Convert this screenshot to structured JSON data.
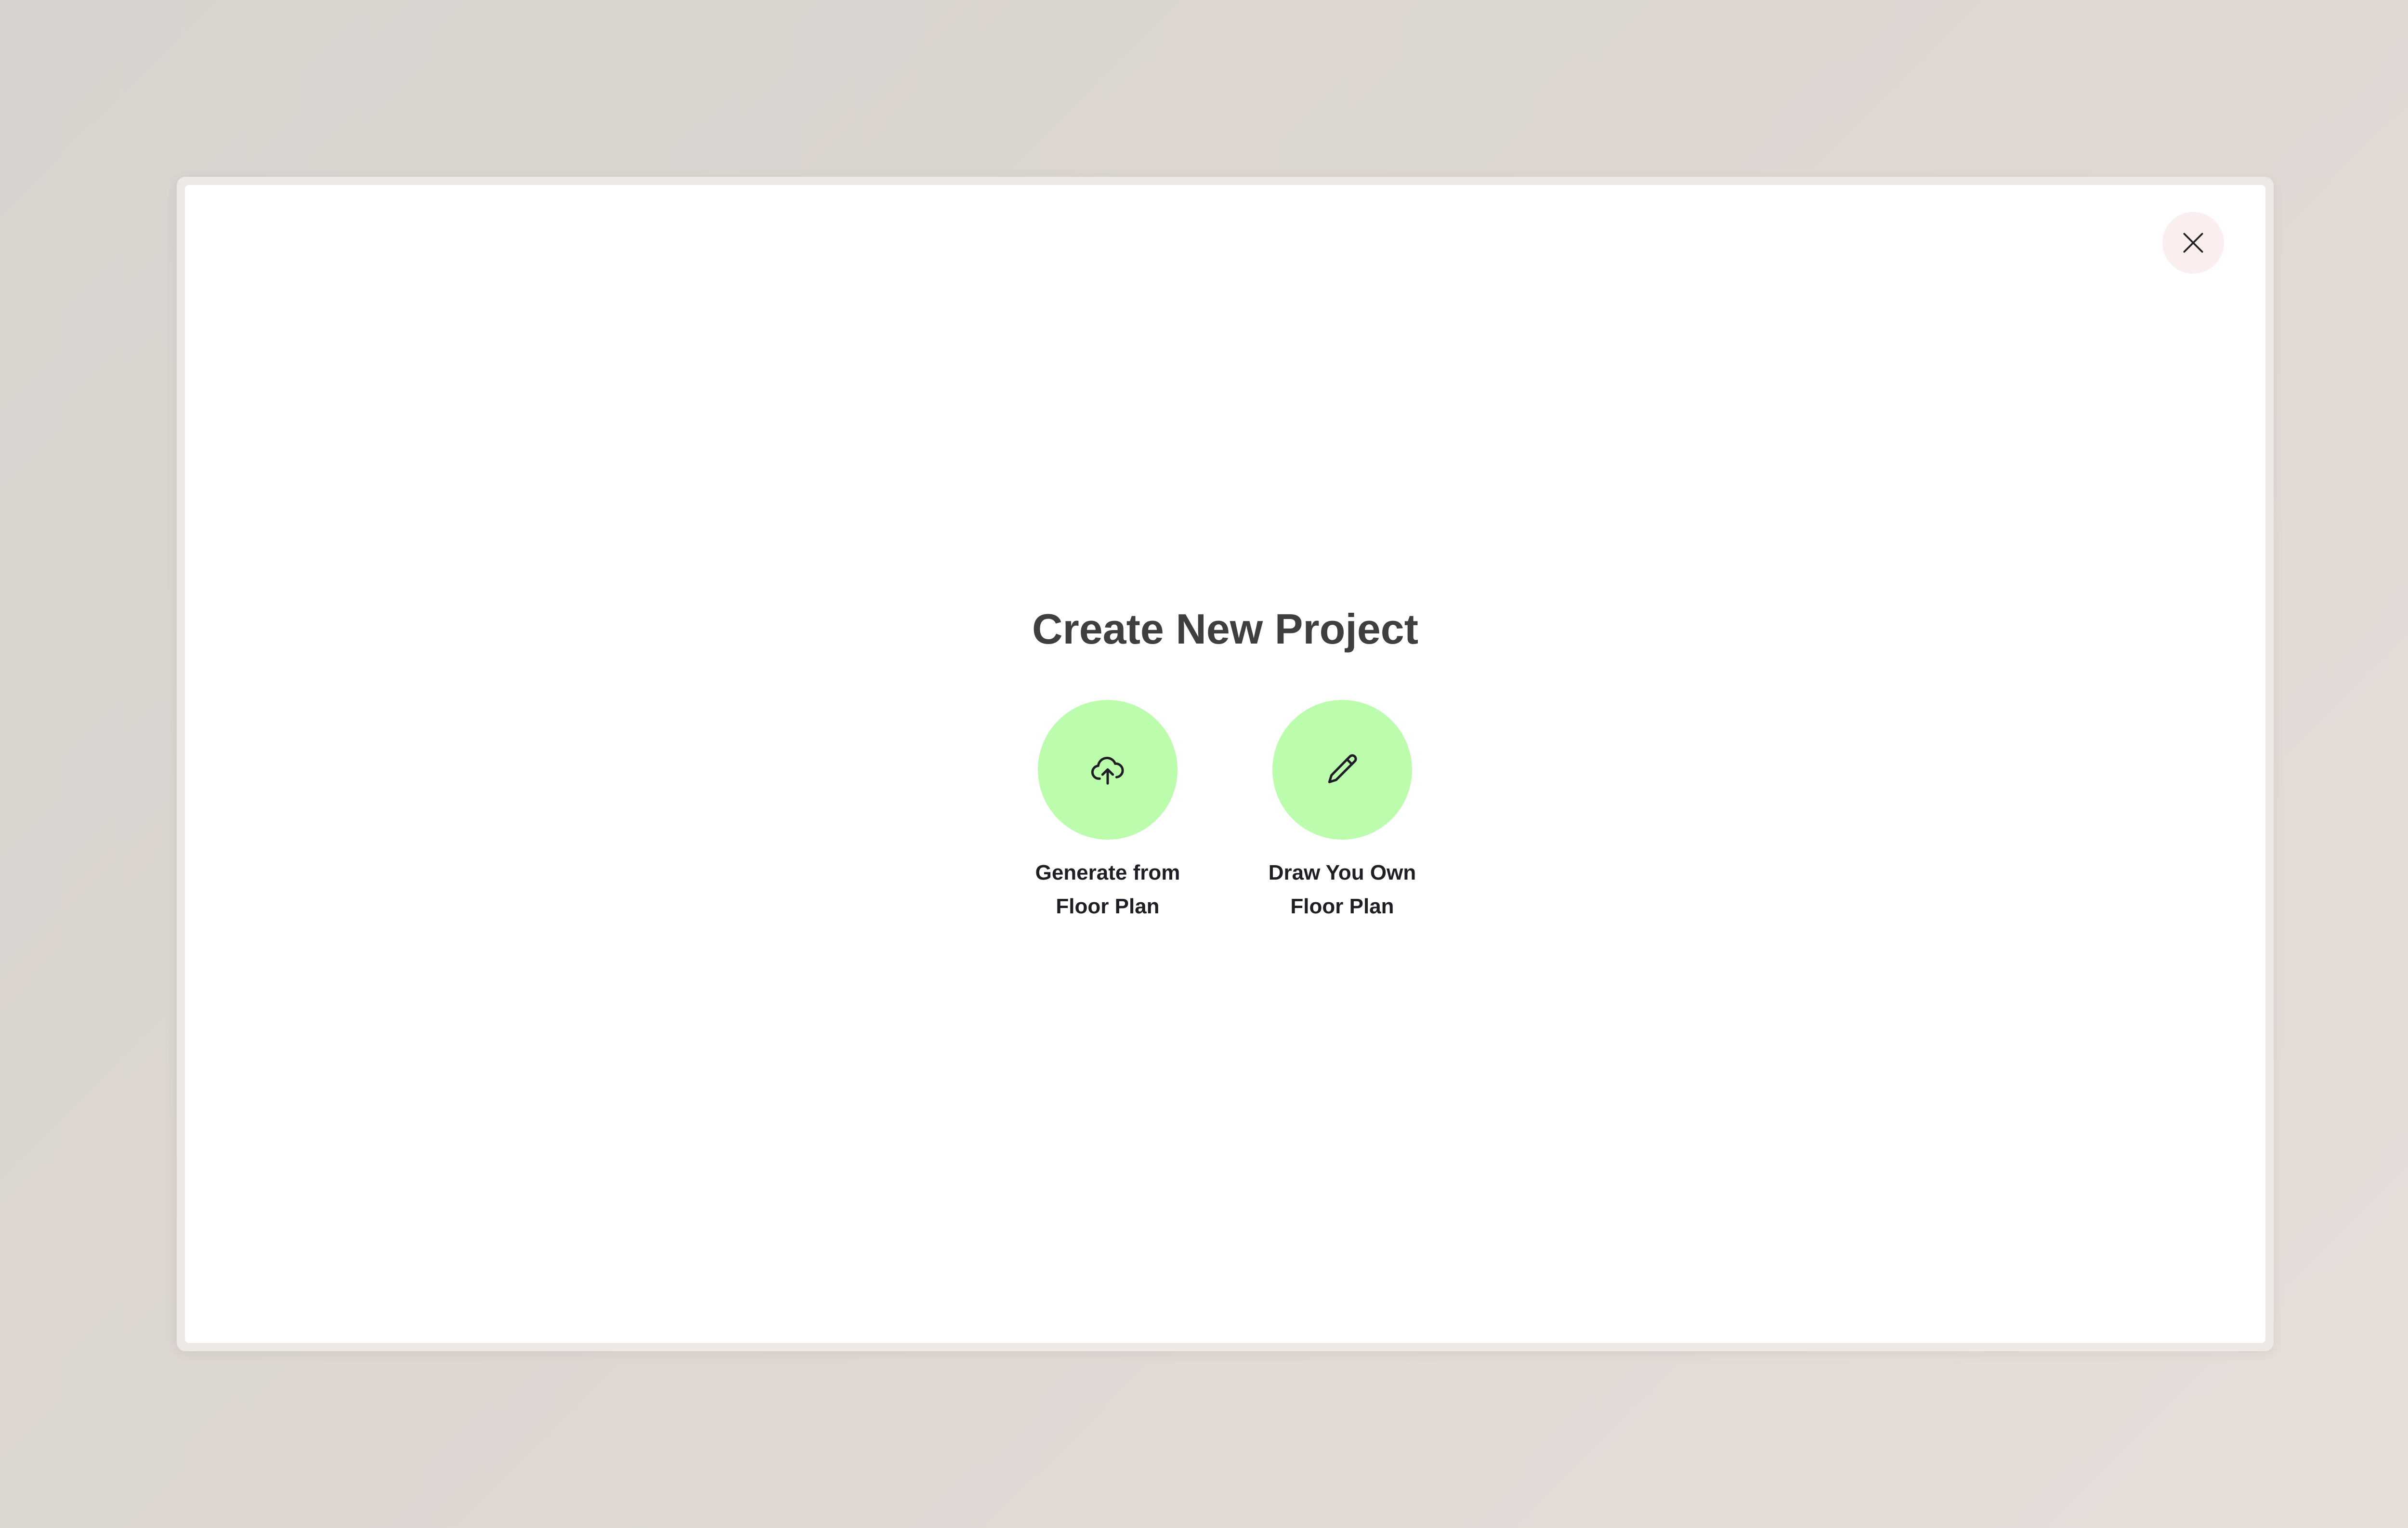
{
  "modal": {
    "title": "Create New Project",
    "close_icon": "close-icon",
    "options": [
      {
        "label": "Generate from\nFloor Plan",
        "icon": "cloud-upload-icon"
      },
      {
        "label": "Draw You Own\nFloor Plan",
        "icon": "pencil-icon"
      }
    ]
  },
  "colors": {
    "option_circle": "#bbfcad",
    "close_button_bg": "#fbeeee",
    "title_text": "#3f3f3f"
  }
}
